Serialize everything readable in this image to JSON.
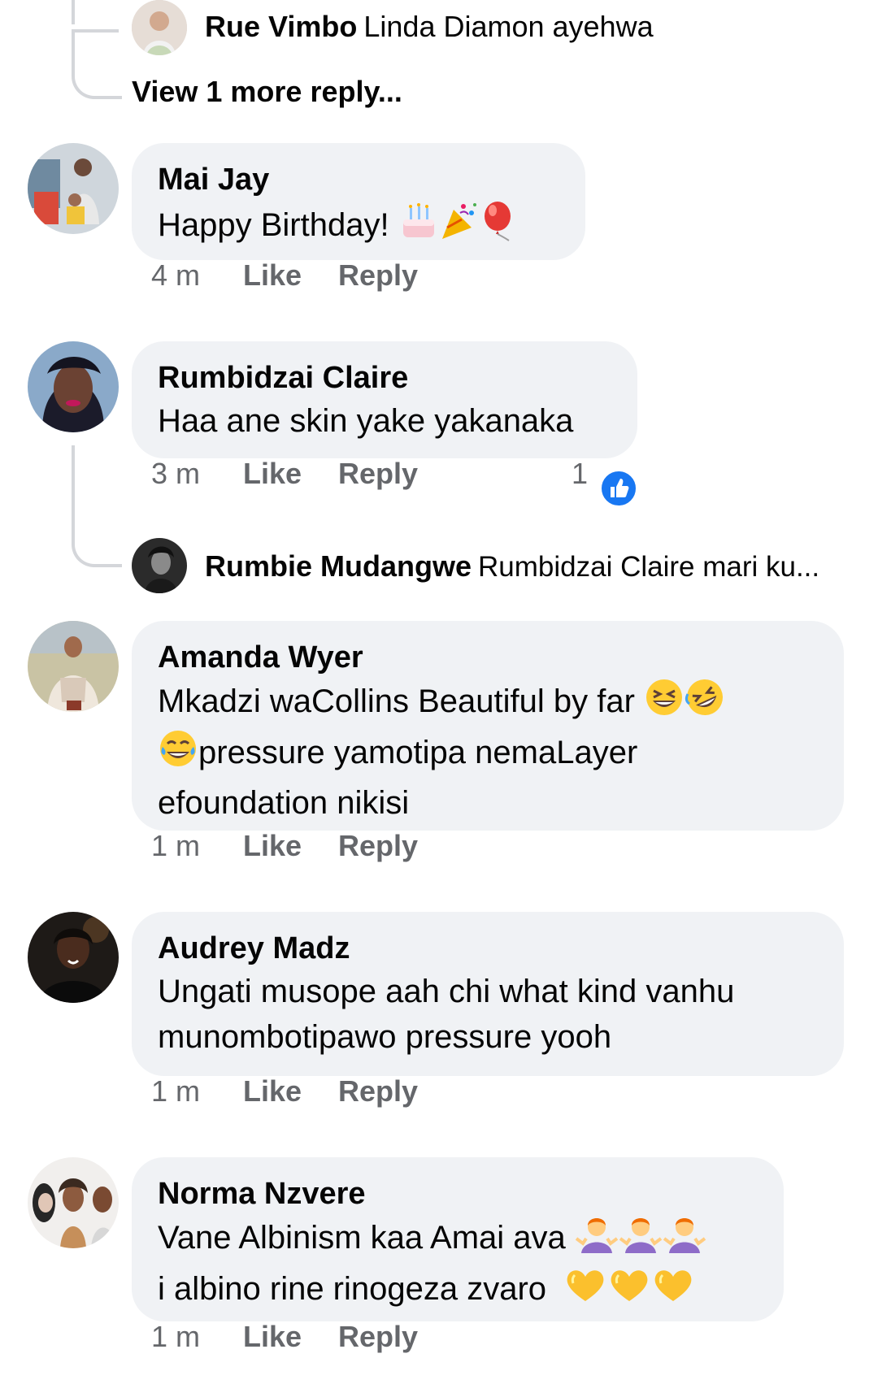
{
  "colors": {
    "bubble": "#f0f2f5",
    "meta": "#65676b",
    "text": "#050505",
    "like_blue": "#1877f2",
    "thread_line": "#d4d6da"
  },
  "top_reply": {
    "name": "Rue Vimbo",
    "text": "Linda Diamon ayehwa"
  },
  "view_more": "View 1 more reply...",
  "comments": [
    {
      "name": "Mai Jay",
      "text": "Happy Birthday!",
      "emojis": [
        "birthday-cake-emoji",
        "party-popper-emoji",
        "balloon-emoji"
      ],
      "time": "4 m",
      "like": "Like",
      "reply": "Reply"
    },
    {
      "name": "Rumbidzai Claire",
      "text": "Haa ane skin yake yakanaka",
      "time": "3 m",
      "like": "Like",
      "reply": "Reply",
      "reaction_count": "1",
      "reply_preview": {
        "name": "Rumbie Mudangwe",
        "text": "Rumbidzai Claire mari ku..."
      }
    },
    {
      "name": "Amanda Wyer",
      "text_line1": "Mkadzi waCollins Beautiful by far",
      "text_line2": "pressure yamotipa nemaLayer",
      "text_line3": "efoundation nikisi",
      "time": "1 m",
      "like": "Like",
      "reply": "Reply"
    },
    {
      "name": "Audrey Madz",
      "text_line1": "Ungati musope aah chi what kind vanhu",
      "text_line2": "munombotipawo pressure yooh",
      "time": "1 m",
      "like": "Like",
      "reply": "Reply"
    },
    {
      "name": "Norma Nzvere",
      "text_line1": "Vane Albinism kaa Amai ava",
      "text_line2": "i albino rine rinogeza zvaro",
      "time": "1 m",
      "like": "Like",
      "reply": "Reply"
    }
  ]
}
